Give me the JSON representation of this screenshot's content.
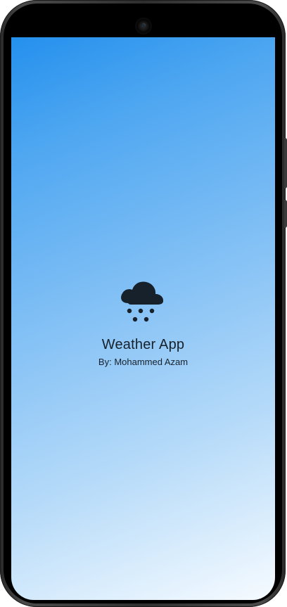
{
  "app": {
    "title": "Weather App",
    "author": "By: Mohammed Azam"
  },
  "icons": {
    "weather": "cloud-snow-icon",
    "camera": "front-camera"
  },
  "colors": {
    "gradient_start": "#2490ed",
    "gradient_end": "#f6fbff",
    "text": "#17212b",
    "device_frame": "#2f2f2f"
  }
}
